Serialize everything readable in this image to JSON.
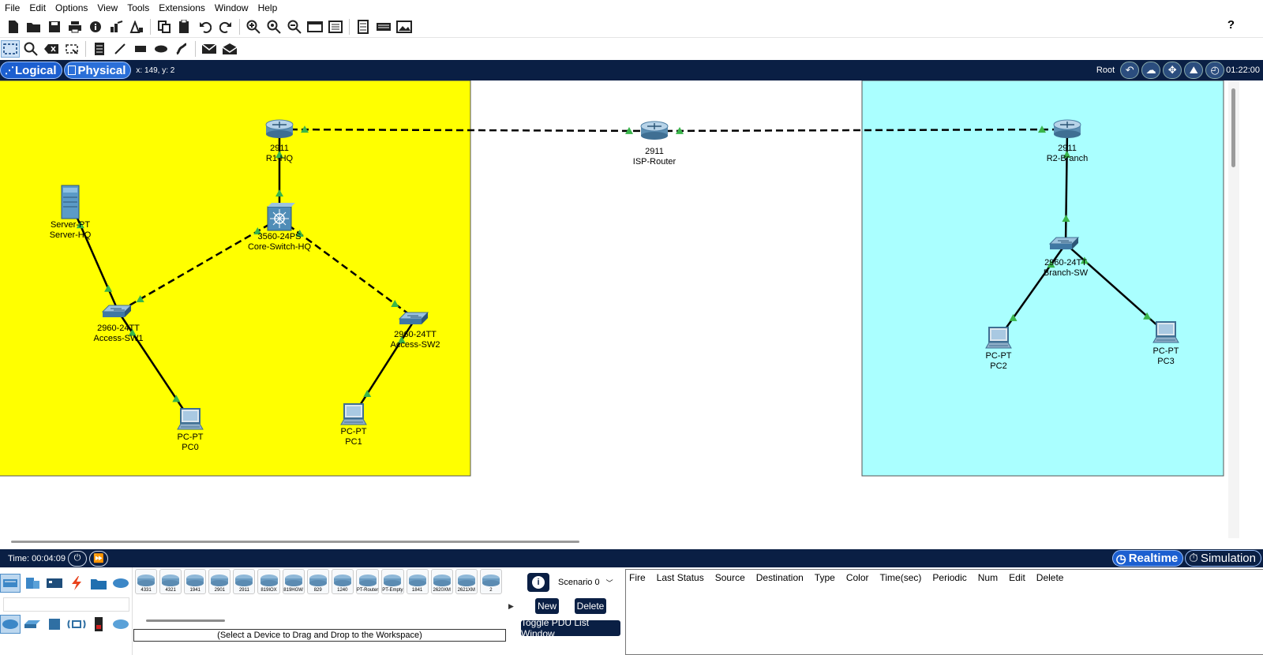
{
  "menu": [
    "File",
    "Edit",
    "Options",
    "View",
    "Tools",
    "Extensions",
    "Window",
    "Help"
  ],
  "workspace": {
    "logical_label": "Logical",
    "physical_label": "Physical",
    "coords": "x: 149, y: 2",
    "root_label": "Root",
    "clock": "01:22:00"
  },
  "zones": {
    "hq_color": "#ffff00",
    "branch_color": "#aaffff"
  },
  "devices": [
    {
      "id": "r1",
      "model": "2911",
      "name": "R1-HQ",
      "icon": "router-icon"
    },
    {
      "id": "isp",
      "model": "2911",
      "name": "ISP-Router",
      "icon": "router-icon"
    },
    {
      "id": "r2",
      "model": "2911",
      "name": "R2-Branch",
      "icon": "router-icon"
    },
    {
      "id": "core",
      "model": "3560-24PS",
      "name": "Core-Switch-HQ",
      "icon": "multilayer-switch-icon"
    },
    {
      "id": "server",
      "model": "Server-PT",
      "name": "Server-HQ",
      "icon": "server-icon"
    },
    {
      "id": "sw1",
      "model": "2960-24TT",
      "name": "Access-SW1",
      "icon": "switch-icon"
    },
    {
      "id": "sw2",
      "model": "2960-24TT",
      "name": "Access-SW2",
      "icon": "switch-icon"
    },
    {
      "id": "bsw",
      "model": "2960-24TT",
      "name": "Branch-SW",
      "icon": "switch-icon"
    },
    {
      "id": "pc0",
      "model": "PC-PT",
      "name": "PC0",
      "icon": "pc-icon"
    },
    {
      "id": "pc1",
      "model": "PC-PT",
      "name": "PC1",
      "icon": "pc-icon"
    },
    {
      "id": "pc2",
      "model": "PC-PT",
      "name": "PC2",
      "icon": "pc-icon"
    },
    {
      "id": "pc3",
      "model": "PC-PT",
      "name": "PC3",
      "icon": "pc-icon"
    }
  ],
  "links": [
    {
      "from": "r1",
      "to": "isp",
      "type": "crossover"
    },
    {
      "from": "isp",
      "to": "r2",
      "type": "crossover"
    },
    {
      "from": "r1",
      "to": "core",
      "type": "straight"
    },
    {
      "from": "core",
      "to": "sw1",
      "type": "crossover"
    },
    {
      "from": "core",
      "to": "sw2",
      "type": "crossover"
    },
    {
      "from": "server",
      "to": "sw1",
      "type": "straight"
    },
    {
      "from": "sw1",
      "to": "pc0",
      "type": "straight"
    },
    {
      "from": "sw2",
      "to": "pc1",
      "type": "straight"
    },
    {
      "from": "r2",
      "to": "bsw",
      "type": "straight"
    },
    {
      "from": "bsw",
      "to": "pc2",
      "type": "straight"
    },
    {
      "from": "bsw",
      "to": "pc3",
      "type": "straight"
    }
  ],
  "link_status_color": "#39b54a",
  "timebar": {
    "time": "Time: 00:04:09",
    "realtime_label": "Realtime",
    "simulation_label": "Simulation"
  },
  "device_models": [
    "4331",
    "4321",
    "1941",
    "2901",
    "2911",
    "819IOX",
    "819HGW",
    "829",
    "1240",
    "PT-Router",
    "PT-Empty",
    "1841",
    "2620XM",
    "2621XM",
    "2"
  ],
  "device_hint": "(Select a Device to Drag and Drop to the Workspace)",
  "scenario": {
    "selected": "Scenario 0",
    "new_label": "New",
    "delete_label": "Delete",
    "toggle_label": "Toggle PDU List Window"
  },
  "pdu_columns": [
    "Fire",
    "Last Status",
    "Source",
    "Destination",
    "Type",
    "Color",
    "Time(sec)",
    "Periodic",
    "Num",
    "Edit",
    "Delete"
  ]
}
